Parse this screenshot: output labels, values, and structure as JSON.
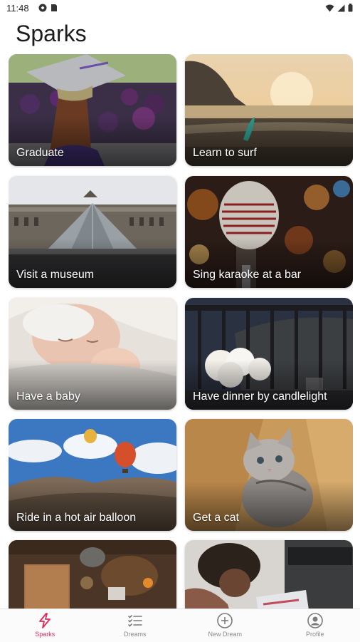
{
  "status": {
    "time": "11:48"
  },
  "title": "Sparks",
  "cards": [
    {
      "label": "Graduate",
      "image": "graduation-photo"
    },
    {
      "label": "Learn to surf",
      "image": "beach-surfboard-photo"
    },
    {
      "label": "Visit a museum",
      "image": "louvre-pyramid-photo"
    },
    {
      "label": "Sing karaoke at a bar",
      "image": "microphone-photo"
    },
    {
      "label": "Have a baby",
      "image": "sleeping-baby-photo"
    },
    {
      "label": "Have dinner by candlelight",
      "image": "balcony-dinner-photo"
    },
    {
      "label": "Ride in a hot air balloon",
      "image": "hot-air-balloons-photo"
    },
    {
      "label": "Get a cat",
      "image": "kitten-in-box-photo"
    },
    {
      "label": "",
      "image": "kitchen-table-photo"
    },
    {
      "label": "",
      "image": "person-with-laptop-photo"
    }
  ],
  "nav": {
    "sparks": "Sparks",
    "dreams": "Dreams",
    "new_dream": "New Dream",
    "profile": "Profile"
  },
  "colors": {
    "accent": "#e2285a",
    "inactive": "#8a8a8a"
  }
}
